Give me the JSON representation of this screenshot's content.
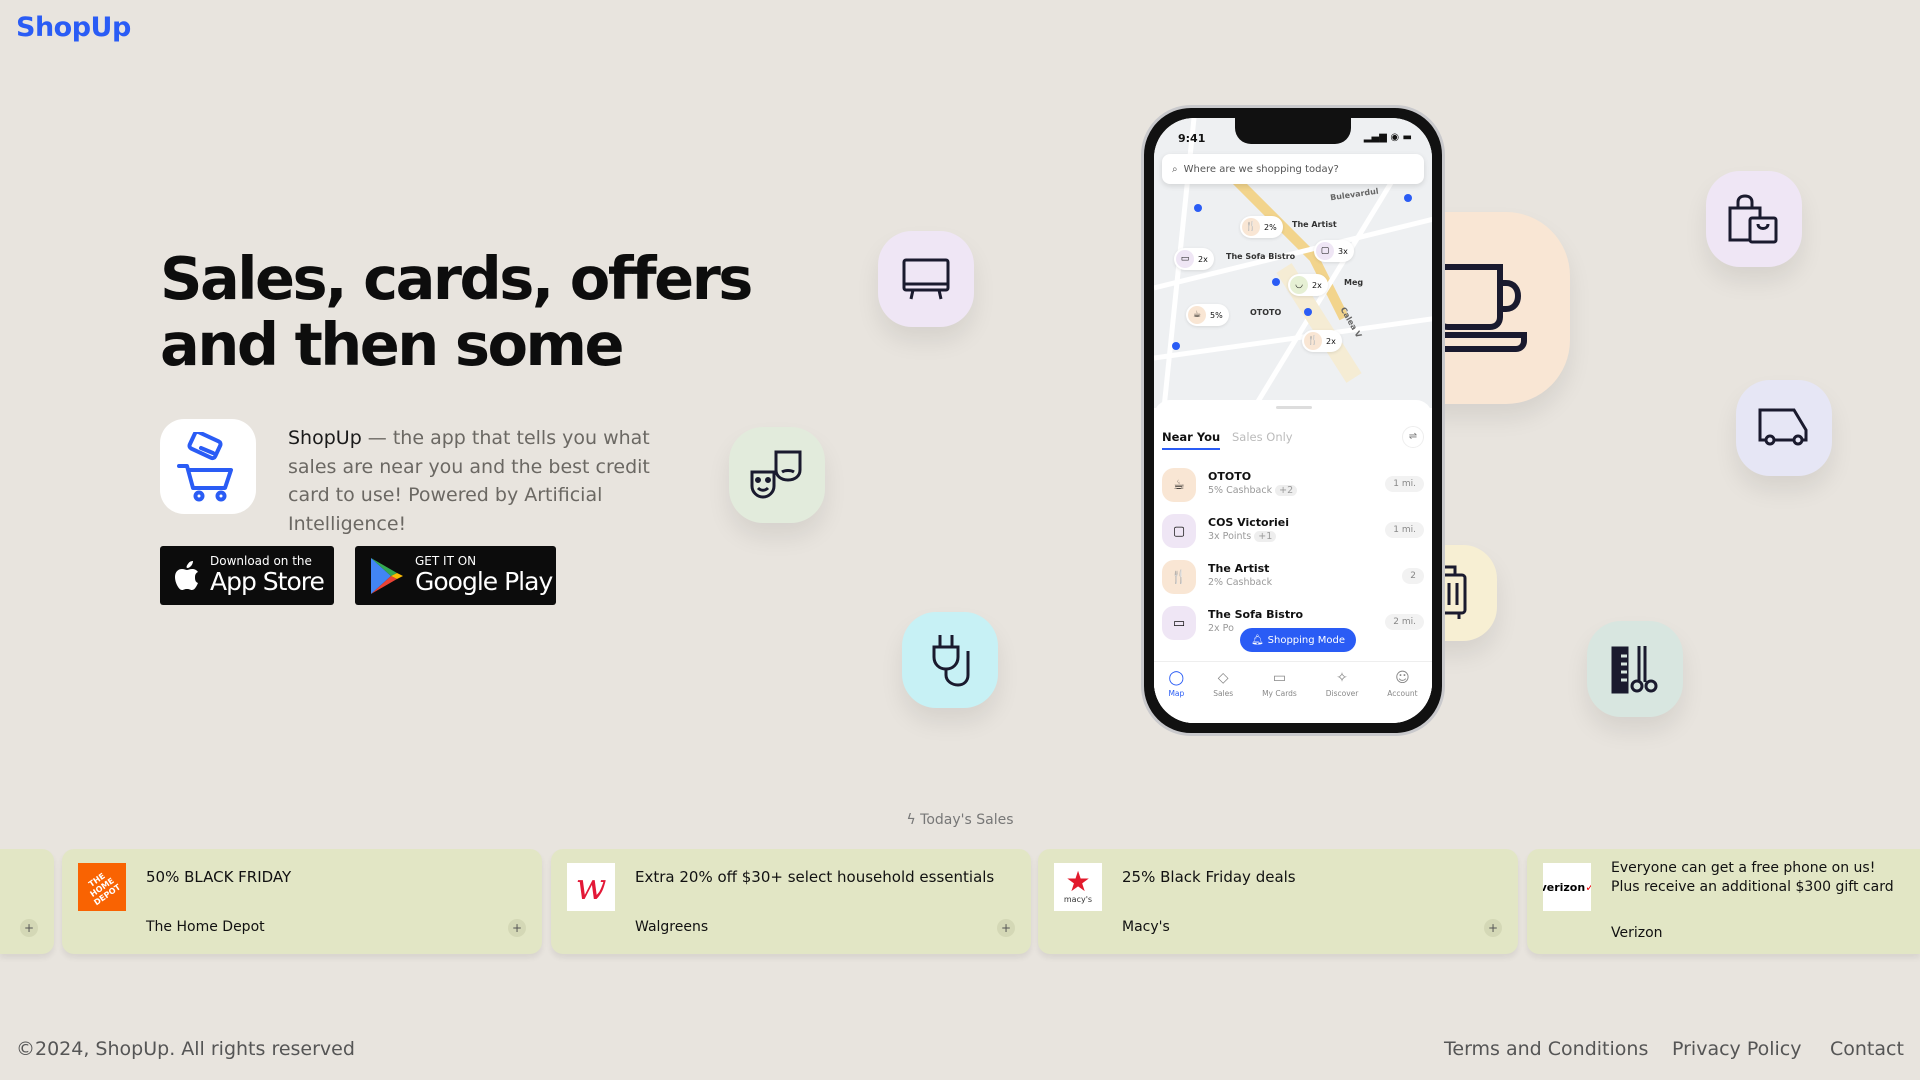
{
  "brand": "ShopUp",
  "hero": {
    "headline_line1": "Sales, cards, offers",
    "headline_line2": "and then some",
    "desc_brand": "ShopUp",
    "desc_rest": " — the app that tells you what sales are near you and the best credit card to use! Powered by Artificial Intelligence!",
    "appstore": {
      "small": "Download on the",
      "big": "App Store"
    },
    "googleplay": {
      "small": "GET IT ON",
      "big": "Google Play"
    }
  },
  "phone": {
    "time": "9:41",
    "search_placeholder": "Where are we shopping today?",
    "map_pins": [
      {
        "value": "2%",
        "label": "The Artist"
      },
      {
        "value": "2x",
        "label": "The Sofa Bistro"
      },
      {
        "value": "3x",
        "label": ""
      },
      {
        "value": "2x",
        "label": "Meg"
      },
      {
        "value": "5%",
        "label": "OTOTO"
      },
      {
        "value": "2x",
        "label": ""
      }
    ],
    "street_labels": [
      "Bulevardul",
      "Calea V"
    ],
    "tabs": [
      "Near You",
      "Sales Only"
    ],
    "list": [
      {
        "name": "OTOTO",
        "sub": "5% Cashback",
        "extra": "+2",
        "dist": "1 mi."
      },
      {
        "name": "COS Victoriei",
        "sub": "3x Points",
        "extra": "+1",
        "dist": "1 mi."
      },
      {
        "name": "The Artist",
        "sub": "2% Cashback",
        "extra": "",
        "dist": "2"
      },
      {
        "name": "The Sofa Bistro",
        "sub": "2x Po",
        "extra": "",
        "dist": "2 mi."
      }
    ],
    "shopping_mode": "Shopping Mode",
    "nav": [
      "Map",
      "Sales",
      "My Cards",
      "Discover",
      "Account"
    ]
  },
  "todays_sales_label": "Today's Sales",
  "sales": [
    {
      "title": "50% BLACK FRIDAY",
      "store": "The Home Depot"
    },
    {
      "title": "Extra 20% off $30+ select household essentials",
      "store": "Walgreens"
    },
    {
      "title": "25% Black Friday deals",
      "store": "Macy's"
    },
    {
      "title": "Everyone can get a free phone on us! Plus receive an additional $300 gift card",
      "store": "Verizon"
    }
  ],
  "logos": {
    "homedepot": "THE HOME DEPOT",
    "walgreens": "W",
    "macys": "macy's",
    "verizon": "verizon"
  },
  "footer": {
    "copyright": "©2024, ShopUp. All rights reserved",
    "links": [
      "Terms and Conditions",
      "Privacy Policy",
      "Contact"
    ]
  },
  "colors": {
    "brand": "#2a5cf5",
    "background": "#e8e4de",
    "card": "#e2e6c5"
  }
}
